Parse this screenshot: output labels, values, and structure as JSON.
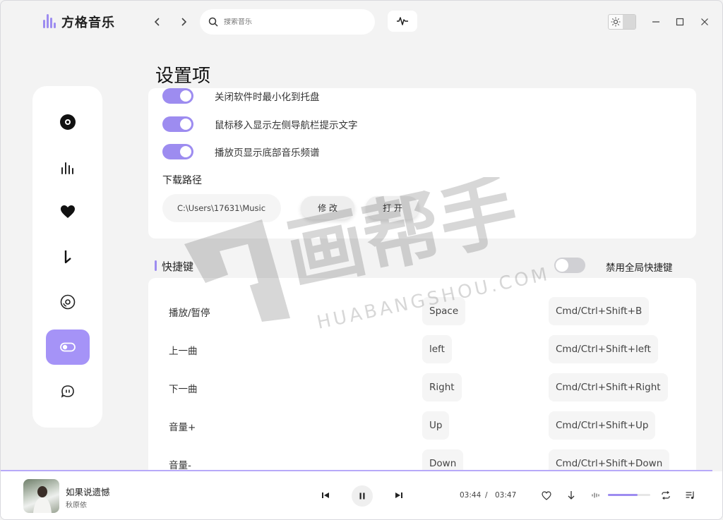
{
  "app": {
    "name": "方格音乐",
    "search_placeholder": "搜索音乐"
  },
  "page": {
    "title": "设置项"
  },
  "general": {
    "toggles": [
      {
        "label": "关闭软件时最小化到托盘",
        "on": true
      },
      {
        "label": "鼠标移入显示左侧导航栏提示文字",
        "on": true
      },
      {
        "label": "播放页显示底部音乐频谱",
        "on": true
      }
    ],
    "download_path_label": "下载路径",
    "download_path_value": "C:\\Users\\17631\\Music",
    "modify_label": "修 改",
    "open_label": "打 开"
  },
  "shortcuts": {
    "section_title": "快捷键",
    "disable_global_label": "禁用全局快捷键",
    "disable_global_on": false,
    "items": [
      {
        "name": "播放/暂停",
        "local": "Space",
        "global": "Cmd/Ctrl+Shift+B"
      },
      {
        "name": "上一曲",
        "local": "left",
        "global": "Cmd/Ctrl+Shift+left"
      },
      {
        "name": "下一曲",
        "local": "Right",
        "global": "Cmd/Ctrl+Shift+Right"
      },
      {
        "name": "音量+",
        "local": "Up",
        "global": "Cmd/Ctrl+Shift+Up"
      },
      {
        "name": "音量-",
        "local": "Down",
        "global": "Cmd/Ctrl+Shift+Down"
      }
    ]
  },
  "player": {
    "song_title": "如果说遗憾",
    "artist": "秋原依",
    "current_time": "03:44",
    "separator": "/",
    "total_time": "03:47",
    "progress": 0.99,
    "volume": 0.7
  },
  "watermark": {
    "text_cn": "画帮手",
    "text_en": "HUABANGSHOU.COM"
  },
  "colors": {
    "accent": "#9d8cf0",
    "accent_active_bg": "#a593f7"
  }
}
